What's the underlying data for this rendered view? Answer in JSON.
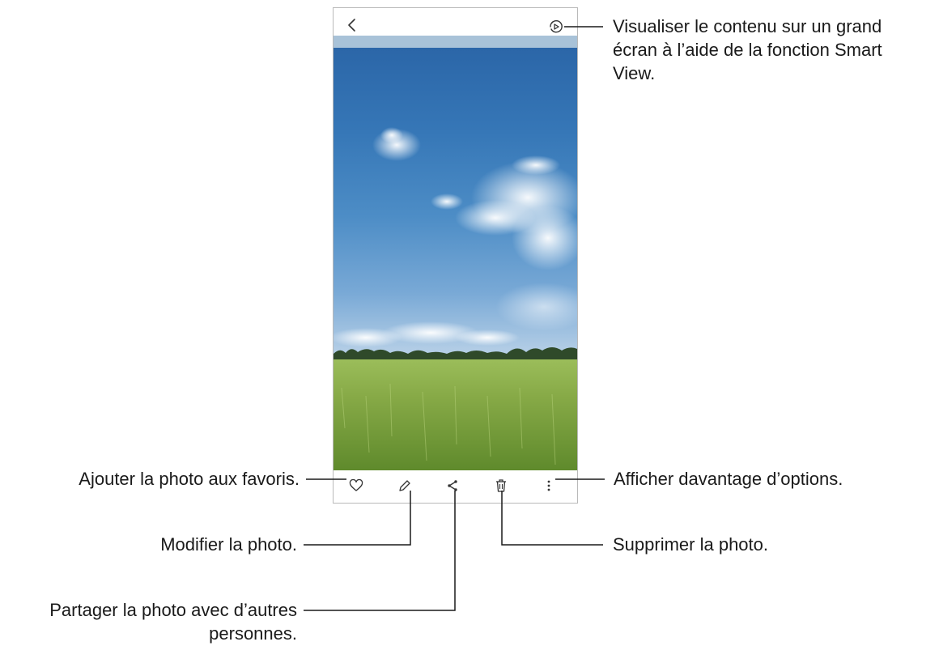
{
  "annotations": {
    "smart_view": {
      "line1": "Visualiser le contenu sur un grand",
      "line2": "écran à l’aide de la fonction Smart",
      "line3": "View."
    },
    "favorite": "Ajouter la photo aux favoris.",
    "edit": "Modifier la photo.",
    "share": {
      "line1": "Partager la photo avec d’autres",
      "line2": "personnes."
    },
    "more": "Afficher davantage d’options.",
    "delete": "Supprimer la photo."
  },
  "icons": {
    "back": "back-chevron-icon",
    "smart_view": "smart-view-icon",
    "favorite": "heart-icon",
    "edit": "pencil-icon",
    "share": "share-icon",
    "delete": "trash-icon",
    "more": "more-options-icon"
  },
  "colors": {
    "sky_top": "#2b66a8",
    "sky_bottom": "#d8e4ee",
    "grass": "#7fa33f",
    "leader_line": "#1a1a1a"
  }
}
